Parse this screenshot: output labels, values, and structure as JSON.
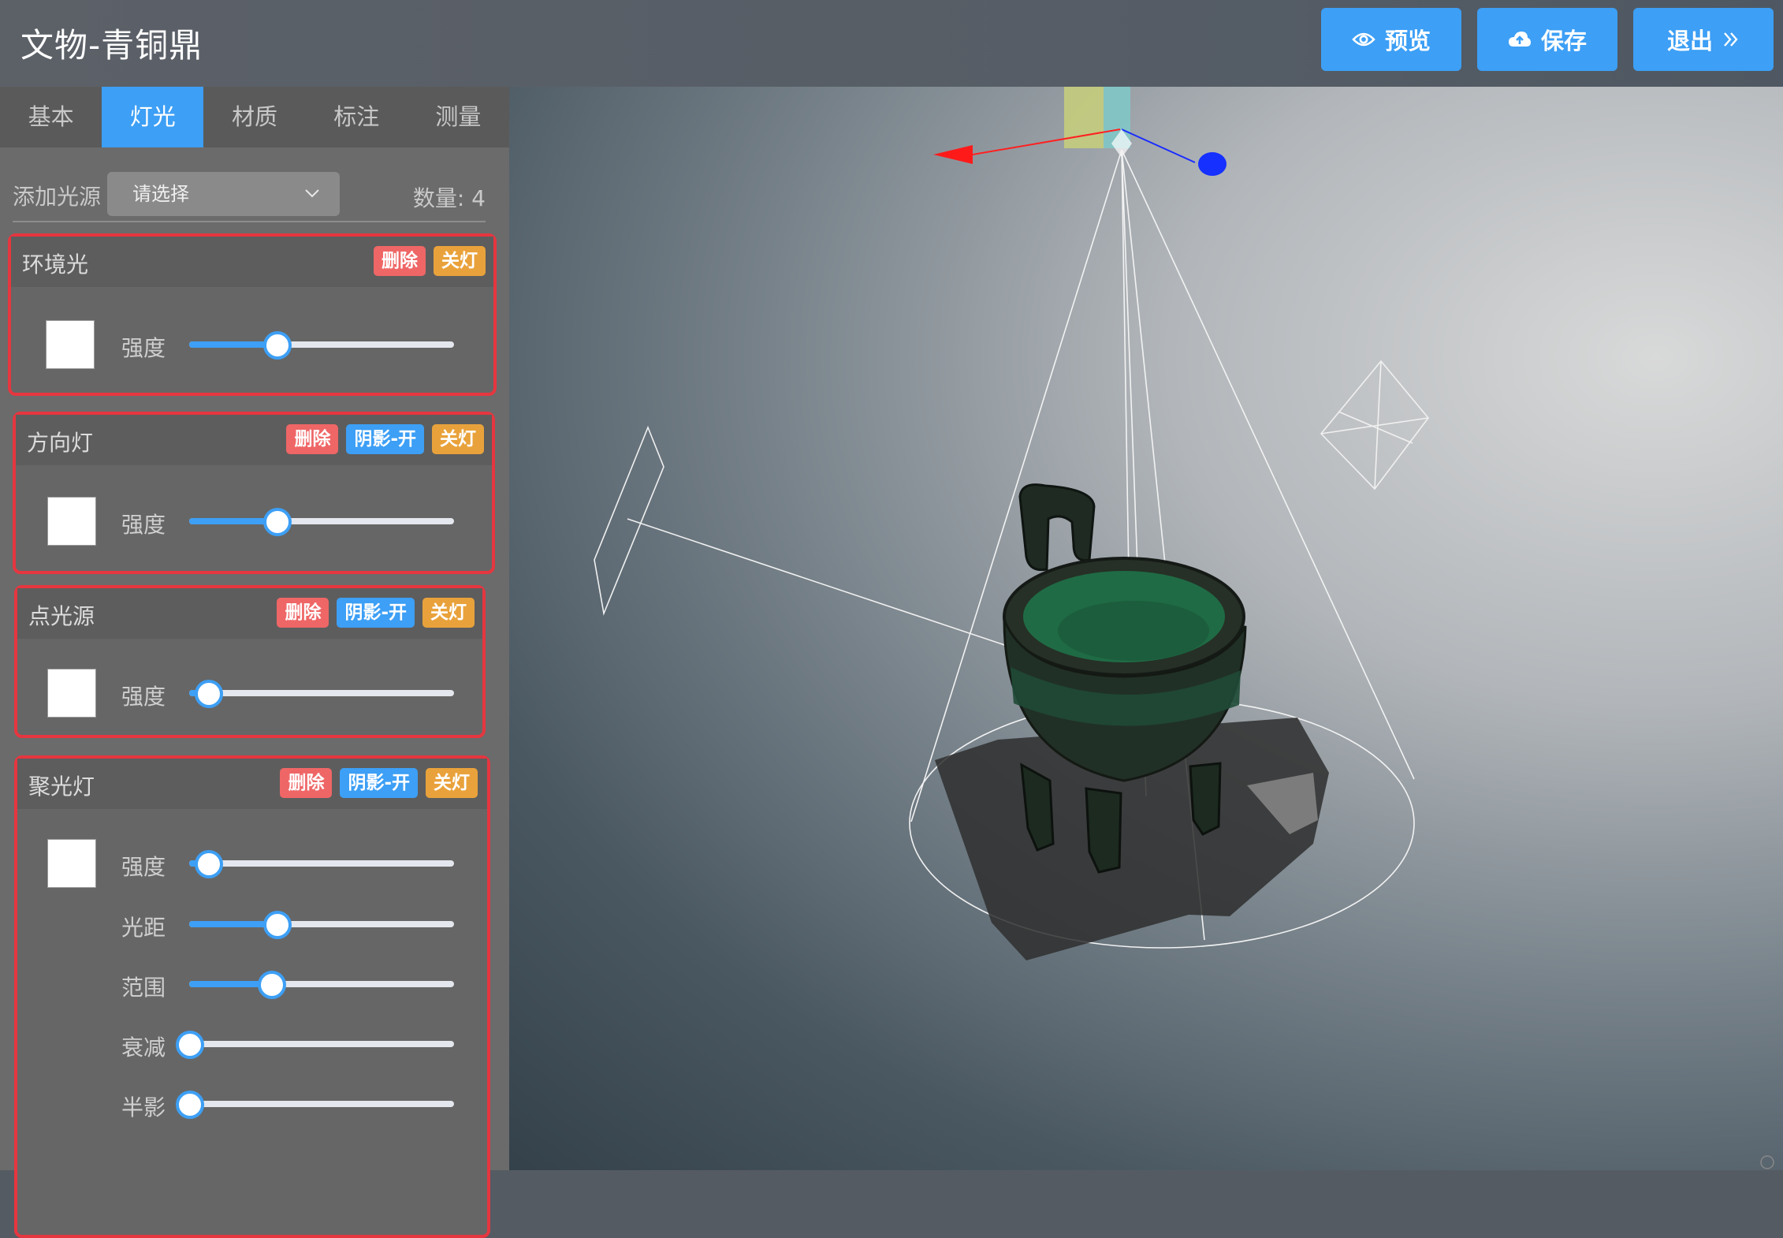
{
  "app": {
    "title": "文物-青铜鼎"
  },
  "toolbar": {
    "preview_label": "预览",
    "save_label": "保存",
    "exit_label": "退出"
  },
  "tabs": [
    {
      "label": "基本",
      "active": false
    },
    {
      "label": "灯光",
      "active": true
    },
    {
      "label": "材质",
      "active": false
    },
    {
      "label": "标注",
      "active": false
    },
    {
      "label": "测量",
      "active": false
    }
  ],
  "add_light": {
    "label": "添加光源",
    "placeholder": "请选择",
    "count_label": "数量: 4"
  },
  "lights": [
    {
      "name": "环境光",
      "delete_label": "删除",
      "toggle_label": "关灯",
      "color": "#ffffff",
      "sliders": [
        {
          "label": "强度",
          "value": 0.33
        }
      ]
    },
    {
      "name": "方向灯",
      "delete_label": "删除",
      "shadow_label": "阴影-开",
      "toggle_label": "关灯",
      "color": "#ffffff",
      "sliders": [
        {
          "label": "强度",
          "value": 0.33
        }
      ]
    },
    {
      "name": "点光源",
      "delete_label": "删除",
      "shadow_label": "阴影-开",
      "toggle_label": "关灯",
      "color": "#ffffff",
      "sliders": [
        {
          "label": "强度",
          "value": 0.07
        }
      ]
    },
    {
      "name": "聚光灯",
      "delete_label": "删除",
      "shadow_label": "阴影-开",
      "toggle_label": "关灯",
      "color": "#ffffff",
      "sliders": [
        {
          "label": "强度",
          "value": 0.07
        },
        {
          "label": "光距",
          "value": 0.33
        },
        {
          "label": "范围",
          "value": 0.31
        },
        {
          "label": "衰减",
          "value": 0.0
        },
        {
          "label": "半影",
          "value": 0.0
        }
      ]
    }
  ],
  "colors": {
    "accent": "#3d9ff5",
    "danger": "#ef6666",
    "warning": "#e9a23b",
    "highlight_border": "#e6363f"
  }
}
